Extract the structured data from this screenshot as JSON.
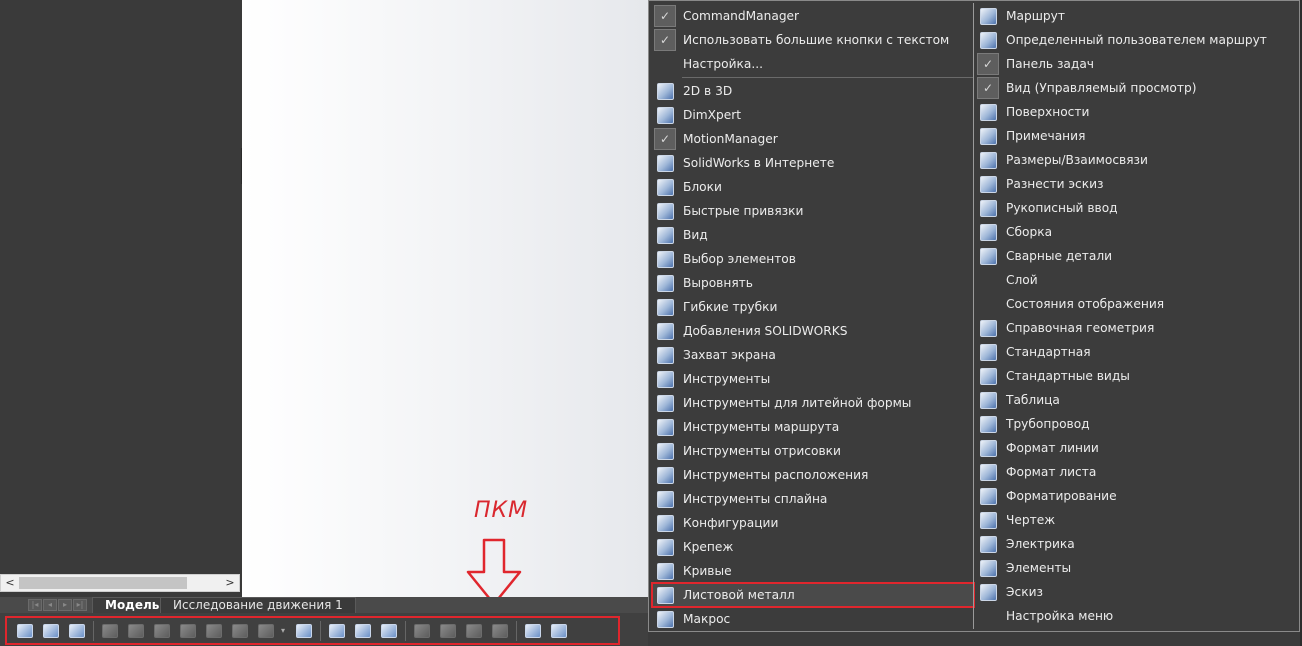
{
  "annotation": {
    "label": "ПКМ"
  },
  "bottom_tabs": {
    "model": "Модель",
    "motion": "Исследование движения 1"
  },
  "scroll": {
    "left_arrow": "<",
    "right_arrow": ">"
  },
  "menu": {
    "col1": [
      {
        "label": "CommandManager",
        "icon": "check-icon",
        "checked": true
      },
      {
        "label": "Использовать большие кнопки с текстом",
        "icon": "check-icon",
        "checked": true
      },
      {
        "label": "Настройка...",
        "icon": "none"
      },
      {
        "separator": true
      },
      {
        "label": "2D в 3D",
        "icon": "2d-to-3d-icon"
      },
      {
        "label": "DimXpert",
        "icon": "dimxpert-icon"
      },
      {
        "label": "MotionManager",
        "icon": "check-icon",
        "checked": true
      },
      {
        "label": "SolidWorks в Интернете",
        "icon": "web-globe-icon"
      },
      {
        "label": "Блоки",
        "icon": "blocks-icon"
      },
      {
        "label": "Быстрые привязки",
        "icon": "quick-snaps-icon"
      },
      {
        "label": "Вид",
        "icon": "view-icon"
      },
      {
        "label": "Выбор элементов",
        "icon": "selection-filter-icon"
      },
      {
        "label": "Выровнять",
        "icon": "align-icon"
      },
      {
        "label": "Гибкие трубки",
        "icon": "flexible-tube-icon"
      },
      {
        "label": "Добавления SOLIDWORKS",
        "icon": "addins-icon"
      },
      {
        "label": "Захват экрана",
        "icon": "screen-capture-icon"
      },
      {
        "label": "Инструменты",
        "icon": "tools-icon"
      },
      {
        "label": "Инструменты для литейной формы",
        "icon": "mold-tools-icon"
      },
      {
        "label": "Инструменты маршрута",
        "icon": "route-tools-icon"
      },
      {
        "label": "Инструменты отрисовки",
        "icon": "render-tools-icon"
      },
      {
        "label": "Инструменты расположения",
        "icon": "layout-tools-icon"
      },
      {
        "label": "Инструменты сплайна",
        "icon": "spline-tools-icon"
      },
      {
        "label": "Конфигурации",
        "icon": "configurations-icon"
      },
      {
        "label": "Крепеж",
        "icon": "fasteners-icon"
      },
      {
        "label": "Кривые",
        "icon": "curves-icon"
      },
      {
        "label": "Листовой металл",
        "icon": "sheet-metal-icon",
        "highlighted": true
      },
      {
        "label": "Макрос",
        "icon": "macro-icon"
      }
    ],
    "col2": [
      {
        "label": "Маршрут",
        "icon": "route-icon"
      },
      {
        "label": "Определенный пользователем маршрут",
        "icon": "user-route-icon"
      },
      {
        "label": "Панель задач",
        "icon": "check-icon",
        "checked": true
      },
      {
        "label": "Вид (Управляемый просмотр)",
        "icon": "check-icon",
        "checked": true
      },
      {
        "label": "Поверхности",
        "icon": "surfaces-icon"
      },
      {
        "label": "Примечания",
        "icon": "annotations-icon"
      },
      {
        "label": "Размеры/Взаимосвязи",
        "icon": "dimensions-icon"
      },
      {
        "label": "Разнести эскиз",
        "icon": "explode-sketch-icon"
      },
      {
        "label": "Рукописный ввод",
        "icon": "ink-markup-icon"
      },
      {
        "label": "Сборка",
        "icon": "assembly-icon"
      },
      {
        "label": "Сварные детали",
        "icon": "weldments-icon"
      },
      {
        "label": "Слой",
        "icon": "none"
      },
      {
        "label": "Состояния отображения",
        "icon": "none"
      },
      {
        "label": "Справочная геометрия",
        "icon": "reference-geometry-icon"
      },
      {
        "label": "Стандартная",
        "icon": "standard-icon"
      },
      {
        "label": "Стандартные виды",
        "icon": "standard-views-icon"
      },
      {
        "label": "Таблица",
        "icon": "table-icon"
      },
      {
        "label": "Трубопровод",
        "icon": "piping-icon"
      },
      {
        "label": "Формат линии",
        "icon": "line-format-icon"
      },
      {
        "label": "Формат листа",
        "icon": "sheet-format-icon"
      },
      {
        "label": "Форматирование",
        "icon": "formatting-icon"
      },
      {
        "label": "Чертеж",
        "icon": "drawing-icon"
      },
      {
        "label": "Электрика",
        "icon": "electrical-icon"
      },
      {
        "label": "Элементы",
        "icon": "features-icon"
      },
      {
        "label": "Эскиз",
        "icon": "sketch-icon"
      },
      {
        "label": "Настройка меню",
        "icon": "none"
      }
    ]
  },
  "toolbar": {
    "icons": [
      {
        "name": "base-flange-icon",
        "state": "on"
      },
      {
        "name": "convert-to-sheet-metal-icon",
        "state": "on"
      },
      {
        "name": "lofted-bend-icon",
        "state": "on"
      },
      {
        "sep": true
      },
      {
        "name": "edge-flange-icon",
        "state": "off"
      },
      {
        "name": "miter-flange-icon",
        "state": "off"
      },
      {
        "name": "hem-icon",
        "state": "off"
      },
      {
        "name": "jog-icon",
        "state": "off"
      },
      {
        "name": "sketched-bend-icon",
        "state": "off"
      },
      {
        "name": "cross-break-icon",
        "state": "off"
      },
      {
        "name": "corners-icon",
        "state": "off"
      },
      {
        "drop": true
      },
      {
        "name": "forming-tool-icon",
        "state": "on"
      },
      {
        "sep": true
      },
      {
        "name": "extruded-cut-icon",
        "state": "on"
      },
      {
        "name": "simple-hole-icon",
        "state": "on"
      },
      {
        "name": "vent-icon",
        "state": "on"
      },
      {
        "sep": true
      },
      {
        "name": "unfold-icon",
        "state": "off"
      },
      {
        "name": "fold-icon",
        "state": "off"
      },
      {
        "name": "flatten-icon",
        "state": "off"
      },
      {
        "name": "no-bends-icon",
        "state": "off"
      },
      {
        "sep": true
      },
      {
        "name": "insert-bends-icon",
        "state": "on"
      },
      {
        "name": "rip-icon",
        "state": "on"
      }
    ]
  }
}
